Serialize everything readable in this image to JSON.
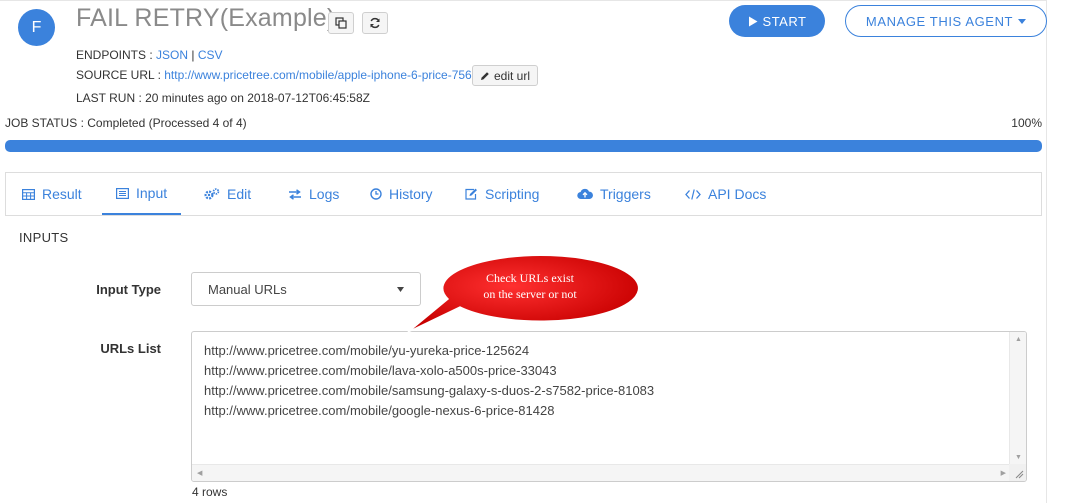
{
  "agent": {
    "avatar_letter": "F",
    "title": "FAIL RETRY(Example)",
    "endpoints_label": "ENDPOINTS : ",
    "endpoint_json": "JSON",
    "endpoint_sep": " | ",
    "endpoint_csv": "CSV",
    "source_url_label": "SOURCE URL : ",
    "source_url": "http://www.pricetree.com/mobile/apple-iphone-6-price-756",
    "edit_url_label": "edit url",
    "last_run": "LAST RUN : 20 minutes ago on 2018-07-12T06:45:58Z"
  },
  "actions": {
    "start_label": "START",
    "manage_label": "MANAGE THIS AGENT"
  },
  "job": {
    "status": "JOB STATUS : Completed (Processed 4 of 4)",
    "percent": "100%",
    "progress_fraction": 1.0
  },
  "tabs": [
    {
      "label": "Result",
      "icon": "table-icon"
    },
    {
      "label": "Input",
      "icon": "list-icon",
      "active": true
    },
    {
      "label": "Edit",
      "icon": "cogs-icon"
    },
    {
      "label": "Logs",
      "icon": "exchange-icon"
    },
    {
      "label": "History",
      "icon": "clock-icon"
    },
    {
      "label": "Scripting",
      "icon": "pencil-square-icon"
    },
    {
      "label": "Triggers",
      "icon": "cloud-upload-icon"
    },
    {
      "label": "API Docs",
      "icon": "code-icon"
    }
  ],
  "inputs": {
    "section_title": "INPUTS",
    "input_type_label": "Input Type",
    "input_type_value": "Manual URLs",
    "urls_label": "URLs List",
    "urls": [
      "http://www.pricetree.com/mobile/yu-yureka-price-125624",
      "http://www.pricetree.com/mobile/lava-xolo-a500s-price-33043",
      "http://www.pricetree.com/mobile/samsung-galaxy-s-duos-2-s7582-price-81083",
      "http://www.pricetree.com/mobile/google-nexus-6-price-81428"
    ],
    "rows_count": "4 rows"
  },
  "annotation": {
    "line1": "Check URLs exist",
    "line2": "on the server or not",
    "color": "#e00000"
  },
  "colors": {
    "accent": "#3b82dc"
  }
}
